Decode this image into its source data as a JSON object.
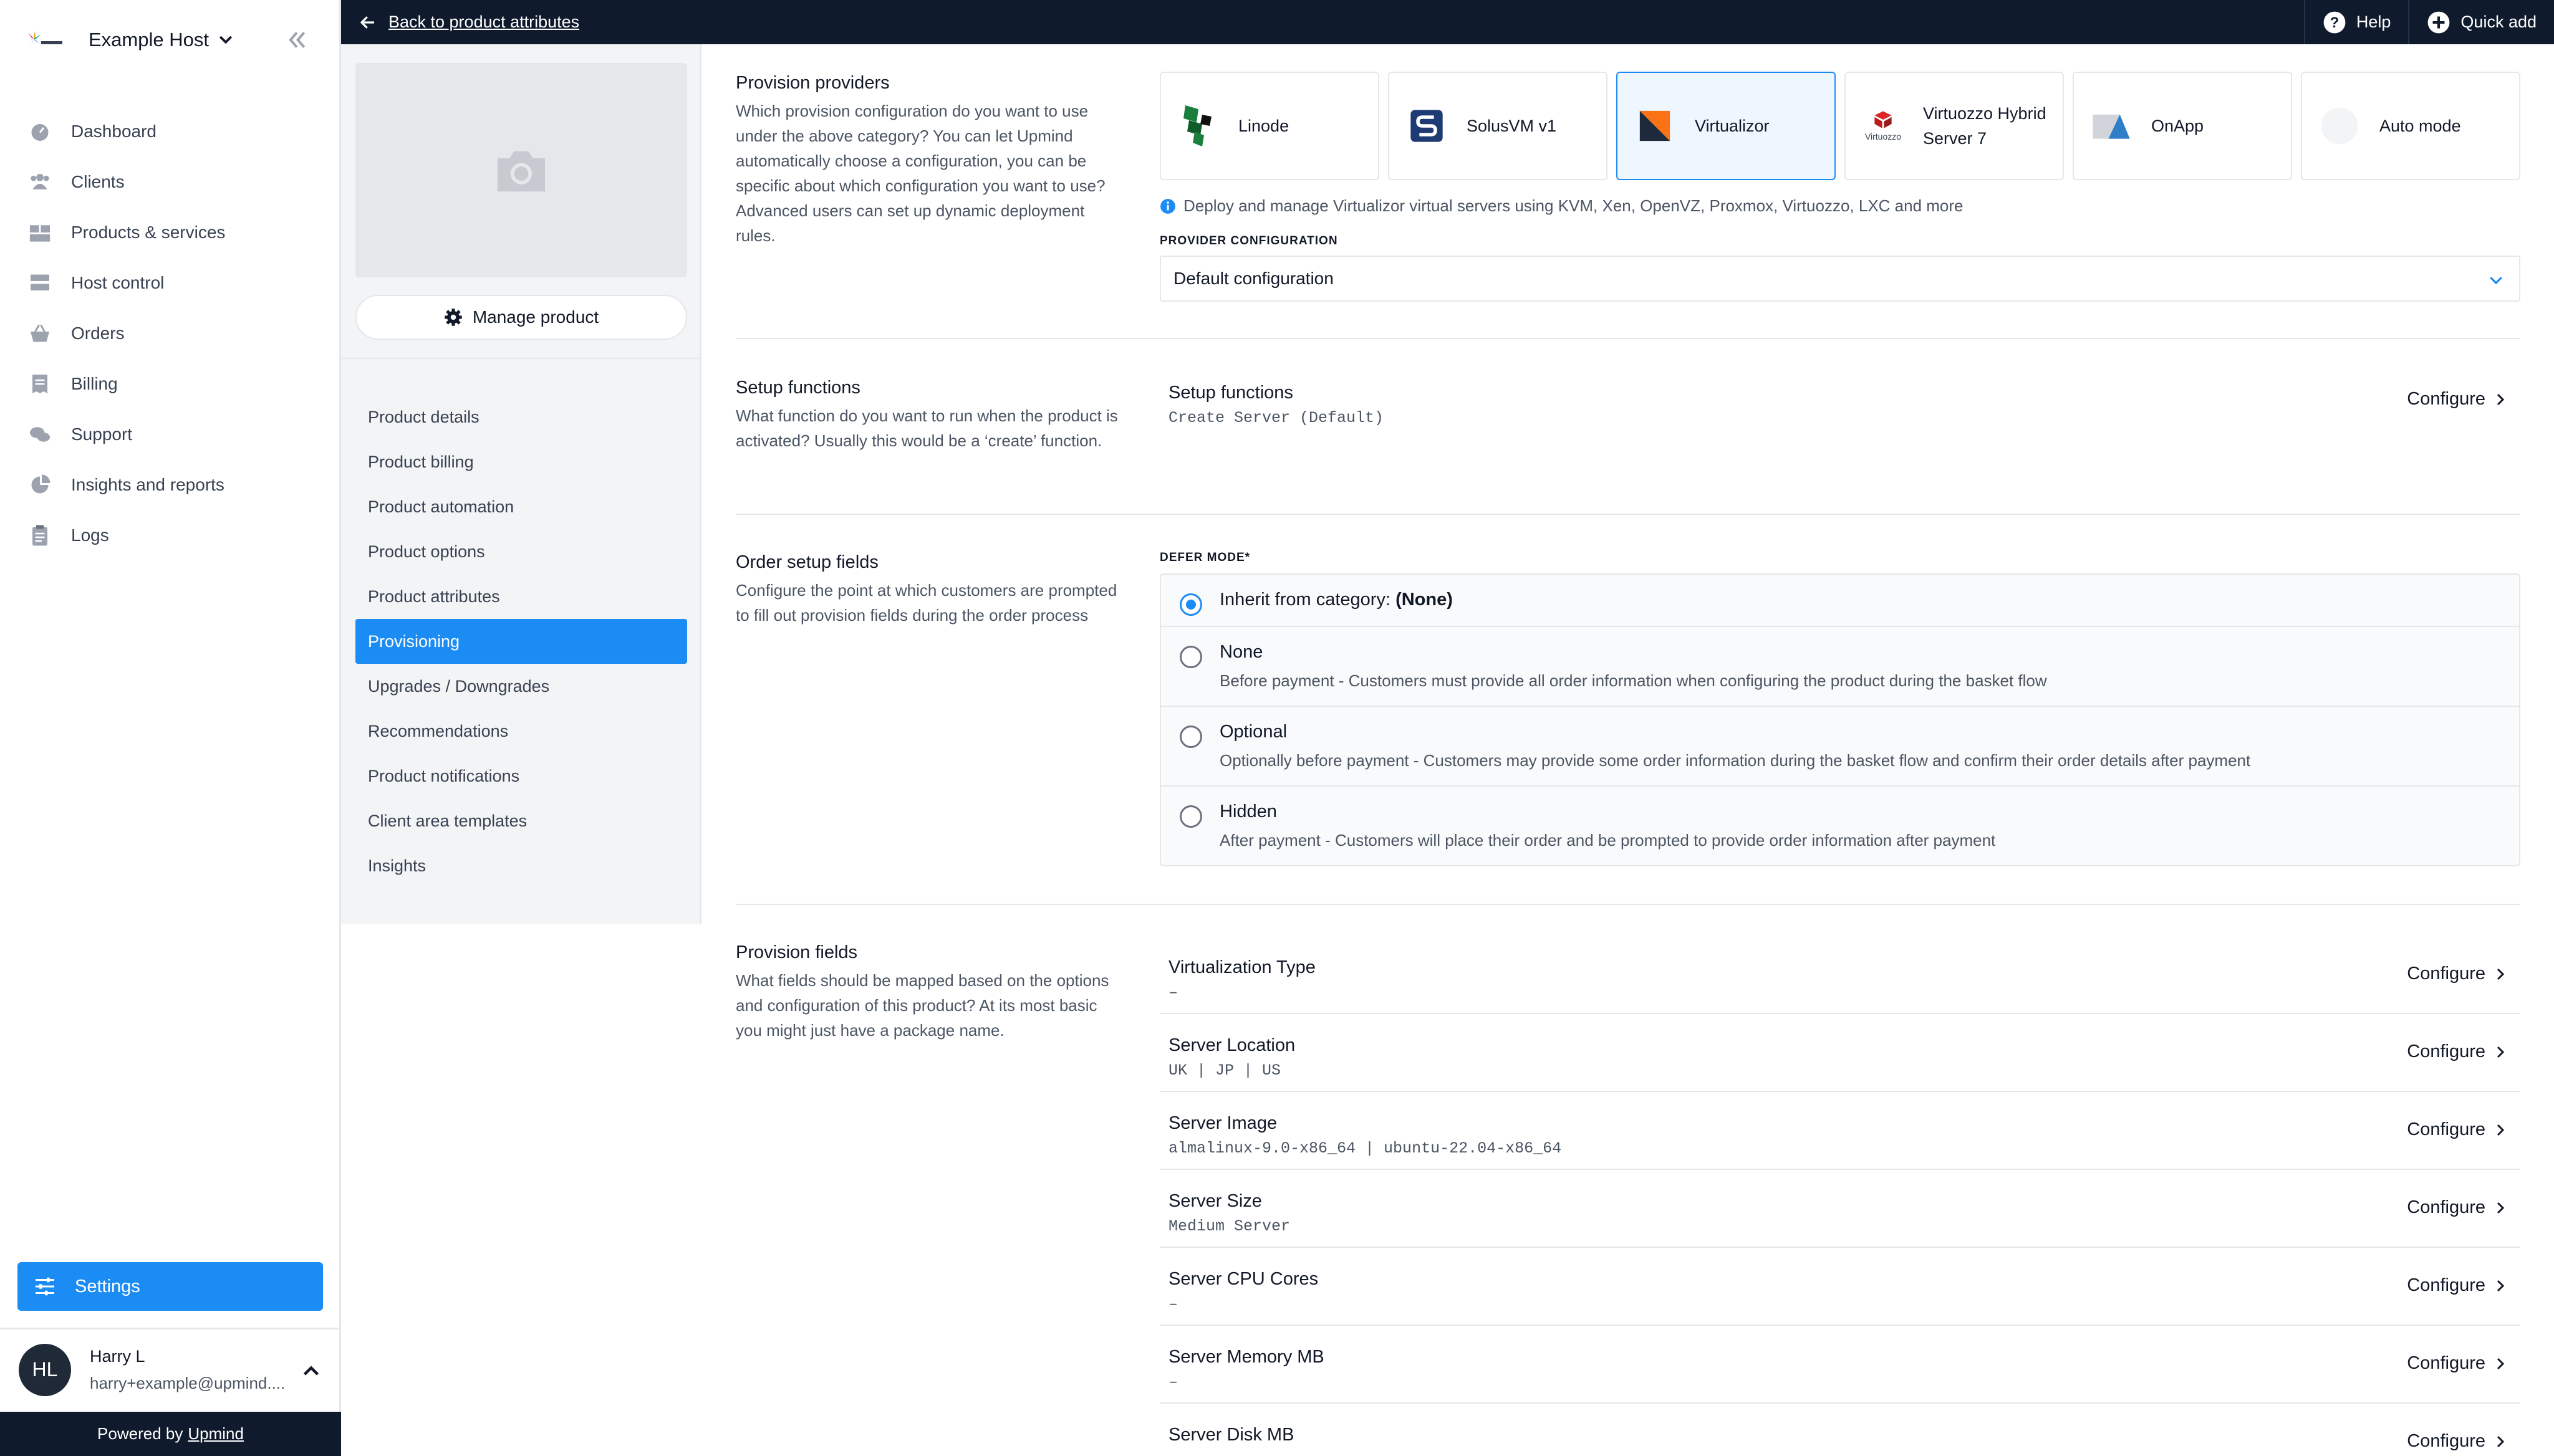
{
  "sidebar": {
    "host_name": "Example Host",
    "nav": [
      {
        "label": "Dashboard",
        "icon": "gauge-icon"
      },
      {
        "label": "Clients",
        "icon": "users-icon"
      },
      {
        "label": "Products & services",
        "icon": "boxes-icon"
      },
      {
        "label": "Host control",
        "icon": "server-icon"
      },
      {
        "label": "Orders",
        "icon": "basket-icon"
      },
      {
        "label": "Billing",
        "icon": "receipt-icon"
      },
      {
        "label": "Support",
        "icon": "chat-icon"
      },
      {
        "label": "Insights and reports",
        "icon": "pie-chart-icon"
      },
      {
        "label": "Logs",
        "icon": "clipboard-icon"
      }
    ],
    "settings_label": "Settings",
    "user": {
      "initials": "HL",
      "name": "Harry L",
      "email": "harry+example@upmind...."
    },
    "powered_by": "Powered by",
    "powered_link": "Upmind"
  },
  "topbar": {
    "back_label": "Back to product attributes",
    "help_label": "Help",
    "quick_add_label": "Quick add"
  },
  "subnav": {
    "manage_label": "Manage product",
    "items": [
      {
        "label": "Product details",
        "active": false
      },
      {
        "label": "Product billing",
        "active": false
      },
      {
        "label": "Product automation",
        "active": false
      },
      {
        "label": "Product options",
        "active": false
      },
      {
        "label": "Product attributes",
        "active": false
      },
      {
        "label": "Provisioning",
        "active": true
      },
      {
        "label": "Upgrades / Downgrades",
        "active": false
      },
      {
        "label": "Recommendations",
        "active": false
      },
      {
        "label": "Product notifications",
        "active": false
      },
      {
        "label": "Client area templates",
        "active": false
      },
      {
        "label": "Insights",
        "active": false
      }
    ]
  },
  "provision_providers": {
    "title": "Provision providers",
    "description": "Which provision configuration do you want to use under the above category? You can let Upmind automatically choose a configuration, you can be specific about which configuration you want to use? Advanced users can set up dynamic deployment rules.",
    "providers": [
      {
        "label": "Linode",
        "selected": false
      },
      {
        "label": "SolusVM v1",
        "selected": false
      },
      {
        "label": "Virtualizor",
        "selected": true
      },
      {
        "label": "Virtuozzo Hybrid Server 7",
        "selected": false,
        "logo_text": "Virtuozzo"
      },
      {
        "label": "OnApp",
        "selected": false
      },
      {
        "label": "Auto mode",
        "selected": false
      }
    ],
    "info": "Deploy and manage Virtualizor virtual servers using KVM, Xen, OpenVZ, Proxmox, Virtuozzo, LXC and more",
    "config_label": "PROVIDER CONFIGURATION",
    "config_value": "Default configuration"
  },
  "setup_functions": {
    "title": "Setup functions",
    "description": "What function do you want to run when the product is activated? Usually this would be a ‘create’ function.",
    "row": {
      "title": "Setup functions",
      "value": "Create Server (Default)",
      "action": "Configure"
    }
  },
  "order_setup": {
    "title": "Order setup fields",
    "description": "Configure the point at which customers are prompted to fill out provision fields during the order process",
    "defer_label": "DEFER MODE*",
    "options": [
      {
        "title_prefix": "Inherit from category: ",
        "title_bold": "(None)",
        "desc": "",
        "checked": true
      },
      {
        "title": "None",
        "desc": "Before payment - Customers must provide all order information when configuring the product during the basket flow",
        "checked": false
      },
      {
        "title": "Optional",
        "desc": "Optionally before payment - Customers may provide some order information during the basket flow and confirm their order details after payment",
        "checked": false
      },
      {
        "title": "Hidden",
        "desc": "After payment - Customers will place their order and be prompted to provide order information after payment",
        "checked": false
      }
    ]
  },
  "provision_fields": {
    "title": "Provision fields",
    "description": "What fields should be mapped based on the options and configuration of this product? At its most basic you might just have a package name.",
    "action": "Configure",
    "rows": [
      {
        "title": "Virtualization Type",
        "value": "–"
      },
      {
        "title": "Server Location",
        "value": "UK | JP | US"
      },
      {
        "title": "Server Image",
        "value": "almalinux-9.0-x86_64 | ubuntu-22.04-x86_64"
      },
      {
        "title": "Server Size",
        "value": "Medium Server"
      },
      {
        "title": "Server CPU Cores",
        "value": "–"
      },
      {
        "title": "Server Memory MB",
        "value": "–"
      },
      {
        "title": "Server Disk MB",
        "value": ""
      }
    ]
  }
}
